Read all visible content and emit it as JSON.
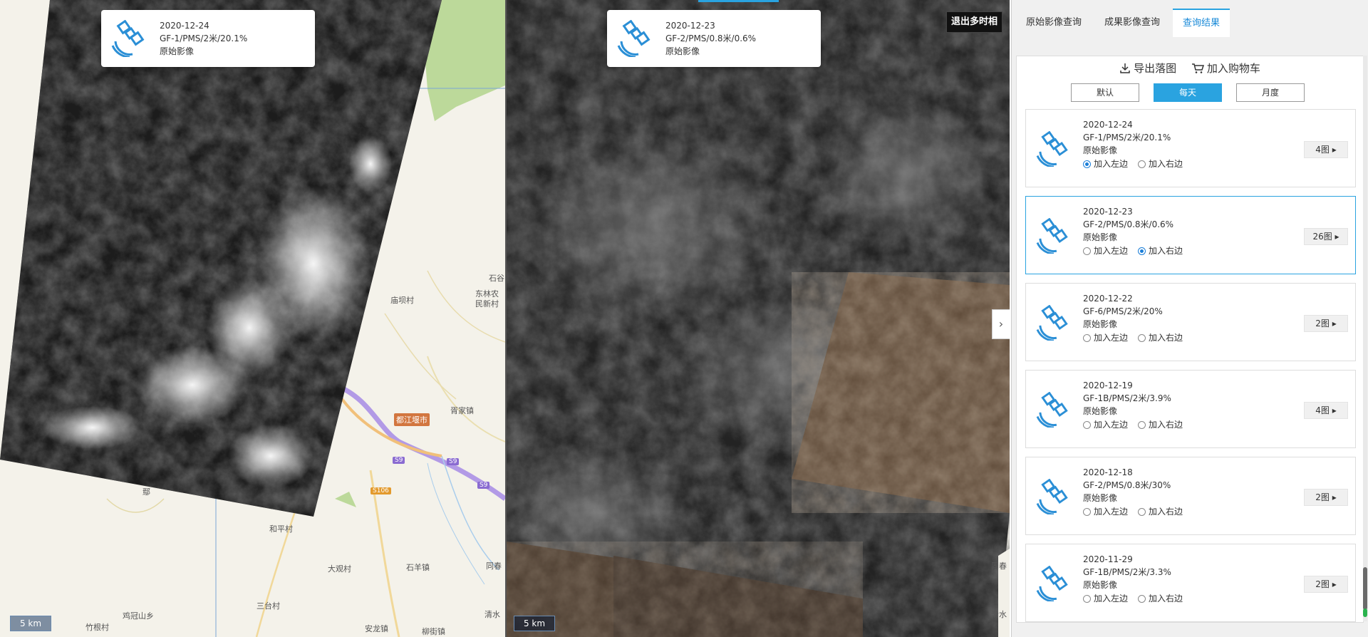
{
  "left_map": {
    "card": {
      "date": "2020-12-24",
      "spec": "GF-1/PMS/2米/20.1%",
      "type": "原始影像"
    },
    "scale": "5 km",
    "places": [
      "庙坝村",
      "东林农",
      "民新村",
      "石谷",
      "胥家镇",
      "和平村",
      "大观村",
      "石羊镇",
      "三台村",
      "鸡冠山乡",
      "竹根村",
      "安龙镇",
      "柳街镇",
      "清水",
      "同春",
      "鄢"
    ],
    "city": "都江堰市",
    "roads": [
      "S9",
      "S9",
      "S9",
      "S106"
    ]
  },
  "right_map": {
    "card": {
      "date": "2020-12-23",
      "spec": "GF-2/PMS/0.8米/0.6%",
      "type": "原始影像"
    },
    "exit_label": "退出多时相",
    "collapse_icon": "›",
    "scale": "5 km",
    "places": [
      "同春",
      "清水"
    ]
  },
  "sidebar": {
    "tabs": [
      {
        "label": "原始影像查询",
        "active": false
      },
      {
        "label": "成果影像查询",
        "active": false
      },
      {
        "label": "查询结果",
        "active": true
      }
    ],
    "actions": {
      "export": "导出落图",
      "cart": "加入购物车"
    },
    "segments": [
      {
        "label": "默认",
        "active": false
      },
      {
        "label": "每天",
        "active": true
      },
      {
        "label": "月度",
        "active": false
      }
    ],
    "radio_left": "加入左边",
    "radio_right": "加入右边",
    "items": [
      {
        "date": "2020-12-24",
        "spec": "GF-1/PMS/2米/20.1%",
        "type": "原始影像",
        "count": "4图 ▸",
        "left": true,
        "right": false,
        "selected": false
      },
      {
        "date": "2020-12-23",
        "spec": "GF-2/PMS/0.8米/0.6%",
        "type": "原始影像",
        "count": "26图 ▸",
        "left": false,
        "right": true,
        "selected": true
      },
      {
        "date": "2020-12-22",
        "spec": "GF-6/PMS/2米/20%",
        "type": "原始影像",
        "count": "2图 ▸",
        "left": false,
        "right": false,
        "selected": false
      },
      {
        "date": "2020-12-19",
        "spec": "GF-1B/PMS/2米/3.9%",
        "type": "原始影像",
        "count": "4图 ▸",
        "left": false,
        "right": false,
        "selected": false
      },
      {
        "date": "2020-12-18",
        "spec": "GF-2/PMS/0.8米/30%",
        "type": "原始影像",
        "count": "2图 ▸",
        "left": false,
        "right": false,
        "selected": false
      },
      {
        "date": "2020-11-29",
        "spec": "GF-1B/PMS/2米/3.3%",
        "type": "原始影像",
        "count": "2图 ▸",
        "left": false,
        "right": false,
        "selected": false
      }
    ]
  },
  "colors": {
    "accent": "#2aa3e0",
    "radio": "#1a7ed8",
    "satellite_icon": "#2b8fd6"
  }
}
